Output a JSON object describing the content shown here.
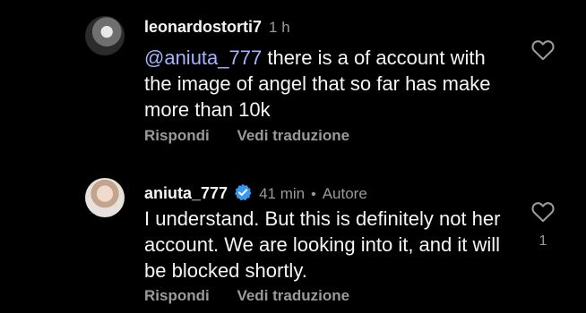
{
  "comments": [
    {
      "username": "leonardostorti7",
      "time": "1 h",
      "mention": "@aniuta_777",
      "text": "there is a of account with the image of angel that so far has make more than 10k",
      "reply_label": "Rispondi",
      "translate_label": "Vedi traduzione",
      "like_count": ""
    },
    {
      "username": "aniuta_777",
      "verified": true,
      "time": "41 min",
      "separator": "•",
      "author_label": "Autore",
      "text": "I understand. But this is definitely not her account. We are looking into it, and it will be blocked shortly.",
      "reply_label": "Rispondi",
      "translate_label": "Vedi traduzione",
      "like_count": "1"
    }
  ],
  "colors": {
    "background": "#000000",
    "text": "#f5f5f5",
    "muted": "#9a9a9a",
    "mention": "#a5b4ff",
    "verified": "#3897f0"
  }
}
